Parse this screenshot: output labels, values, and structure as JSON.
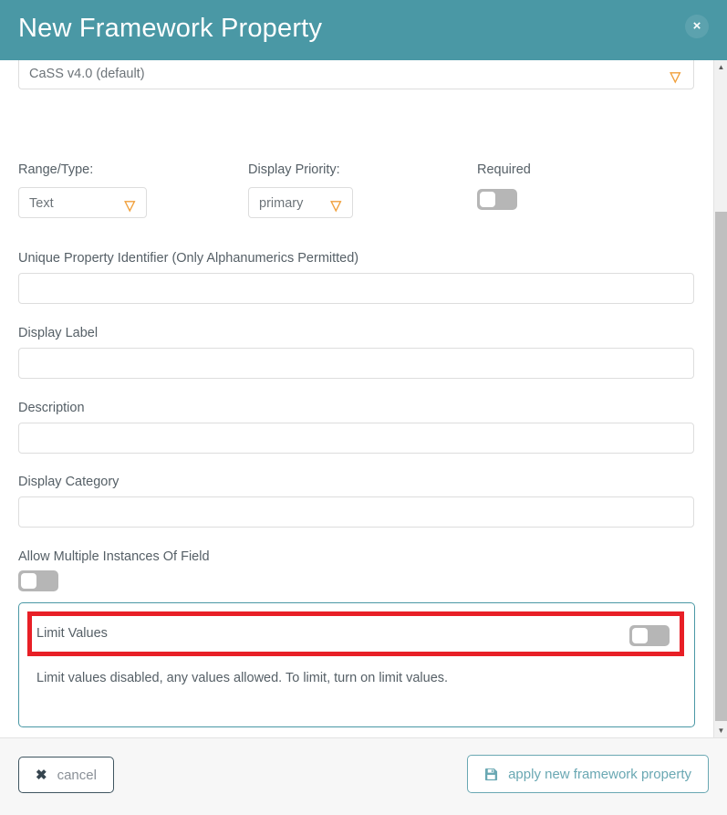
{
  "header": {
    "title": "New Framework Property",
    "close_label": "×",
    "close_icon": "close-icon",
    "background_color": "#4a98a5"
  },
  "form": {
    "framework_select": {
      "label": "",
      "value": "CaSS v4.0 (default)",
      "chevron_icon": "chevron-down-icon"
    },
    "range_type": {
      "label": "Range/Type:",
      "value": "Text",
      "chevron_icon": "chevron-down-icon"
    },
    "display_priority": {
      "label": "Display Priority:",
      "value": "primary",
      "chevron_icon": "chevron-down-icon"
    },
    "required": {
      "label": "Required",
      "state": "off"
    },
    "unique_identifier": {
      "label": "Unique Property Identifier (Only Alphanumerics Permitted)",
      "value": "",
      "placeholder": ""
    },
    "display_label": {
      "label": "Display Label",
      "value": "",
      "placeholder": ""
    },
    "description": {
      "label": "Description",
      "value": "",
      "placeholder": ""
    },
    "display_category": {
      "label": "Display Category",
      "value": "",
      "placeholder": ""
    },
    "allow_multiple": {
      "label": "Allow Multiple Instances Of Field",
      "state": "off"
    },
    "limit_values": {
      "label": "Limit Values",
      "state": "off",
      "description": "Limit values disabled, any values allowed. To limit, turn on limit values.",
      "panel_border_color": "#4a98a5"
    }
  },
  "annotation": {
    "color": "#e81f26",
    "target": "limit-values-row"
  },
  "scrollbar": {
    "up_arrow": "▲",
    "down_arrow": "▼"
  },
  "footer": {
    "cancel": {
      "label": "cancel",
      "icon": "close-icon"
    },
    "apply": {
      "label": "apply new framework property",
      "icon": "save-icon",
      "color": "#6aa8b3"
    }
  }
}
